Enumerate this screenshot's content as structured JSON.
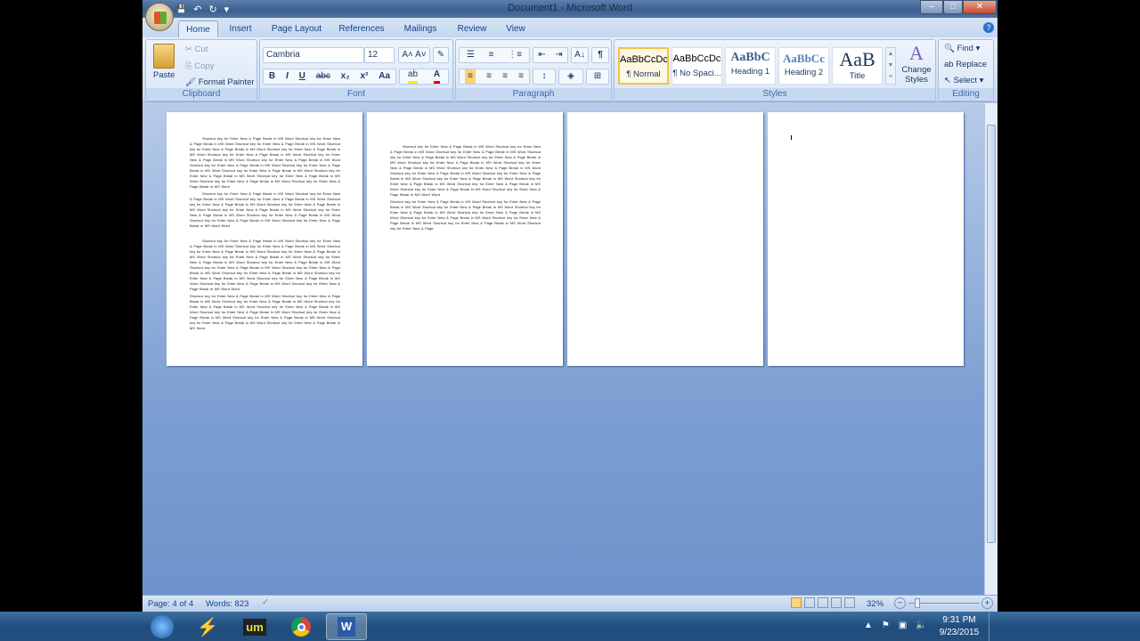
{
  "window": {
    "title": "Document1 - Microsoft Word",
    "min": "–",
    "max": "□",
    "close": "✕"
  },
  "qat": {
    "save": "💾",
    "undo": "↶",
    "redo": "↻",
    "customize": "▾"
  },
  "tabs": [
    "Home",
    "Insert",
    "Page Layout",
    "References",
    "Mailings",
    "Review",
    "View"
  ],
  "help": "?",
  "clipboard": {
    "paste": "Paste",
    "cut": "Cut",
    "copy": "Copy",
    "format_painter": "Format Painter",
    "label": "Clipboard"
  },
  "font": {
    "name": "Cambria",
    "size": "12",
    "grow": "A˄",
    "shrink": "A˅",
    "clear": "✎",
    "bold": "B",
    "italic": "I",
    "underline": "U",
    "strike": "abc",
    "sub": "x₂",
    "sup": "x²",
    "case": "Aa",
    "highlight": "ab",
    "color": "A",
    "label": "Font"
  },
  "paragraph": {
    "bullets": "☰",
    "numbering": "≡",
    "multilevel": "⋮≡",
    "dec_indent": "⇤",
    "inc_indent": "⇥",
    "sort": "A↓",
    "show": "¶",
    "left": "≡",
    "center": "≡",
    "right": "≡",
    "justify": "≡",
    "spacing": "↕",
    "shading": "◈",
    "borders": "⊞",
    "label": "Paragraph"
  },
  "styles": {
    "items": [
      {
        "preview": "AaBbCcDc",
        "name": "¶ Normal"
      },
      {
        "preview": "AaBbCcDc",
        "name": "¶ No Spaci..."
      },
      {
        "preview": "AaBbC",
        "name": "Heading 1"
      },
      {
        "preview": "AaBbCc",
        "name": "Heading 2"
      },
      {
        "preview": "AaB",
        "name": "Title"
      }
    ],
    "change": "Change Styles",
    "label": "Styles"
  },
  "editing": {
    "find": "Find",
    "replace": "Replace",
    "select": "Select",
    "label": "Editing"
  },
  "pages": [
    {
      "paragraphs": [
        "Shortcut key for Enter New & Page Break in MS Word Shortcut key for Enter New & Page Break in MS Word Shortcut key for Enter New & Page Break in MS Word Shortcut key for Enter New & Page Break in MS Word Shortcut key for Enter New & Page Break in MS Word Shortcut key for Enter New & Page Break in MS Word Shortcut key for Enter New & Page Break in MS Word Shortcut key for Enter New & Page Break in MS Word Shortcut key for Enter New & Page Break in MS Word Shortcut key for Enter New & Page Break in MS Word Shortcut key for Enter New & Page Break in MS Word Shortcut key for Enter New & Page Break in MS Word Shortcut key for Enter New & Page Break in MS Word Shortcut key for Enter New & Page Break in MS Word Shortcut key for Enter New & Page Break in MS Word",
        "Shortcut key for Enter New & Page Break in MS Word Shortcut key for Enter New & Page Break in MS Word Shortcut key for Enter New & Page Break in MS Word Shortcut key for Enter New & Page Break in MS Word Shortcut key for Enter New & Page Break in MS Word Shortcut key for Enter New & Page Break in MS Word Shortcut key for Enter New & Page Break in MS Word Shortcut key for Enter New & Page Break in MS Word Shortcut key for Enter New & Page Break in MS Word Shortcut key for Enter New & Page Break in MS Word Word",
        "Shortcut key for Enter New & Page Break in MS Word Shortcut key for Enter New & Page Break in MS Word Shortcut key for Enter New & Page Break in MS Word Shortcut key for Enter New & Page Break in MS Word Shortcut key for Enter New & Page Break in MS Word Shortcut key for Enter New & Page Break in MS Word Shortcut key for Enter New & Page Break in MS Word Shortcut key for Enter New & Page Break in MS Word Shortcut key for Enter New & Page Break in MS Word Shortcut key for Enter New & Page Break in MS Word Shortcut key for Enter New & Page Break in MS Word Shortcut key for Enter New & Page Break in MS Word Shortcut key for Enter New & Page Break in MS Word Shortcut key for Enter New & Page Break in MS Word Shortcut key for Enter New & Page Break in MS Word Word",
        "Shortcut key for Enter New & Page Break in MS Word Shortcut key for Enter New & Page Break in MS Word Shortcut key for Enter New & Page Break in MS Word Shortcut key for Enter New & Page Break in MS Word Shortcut key for Enter New & Page Break in MS Word Shortcut key for Enter New & Page Break in MS Word Shortcut key for Enter New & Page Break in MS Word Shortcut key for Enter New & Page Break in MS Word Shortcut key for Enter New & Page Break in MS Word Shortcut key for Enter New & Page Break in MS Word"
      ]
    },
    {
      "paragraphs": [
        "Shortcut key for Enter New & Page Break in MS Word Shortcut key for Enter New & Page Break in MS Word Shortcut key for Enter New & Page Break in MS Word Shortcut key for Enter New & Page Break in MS Word Shortcut key for Enter New & Page Break in MS Word Shortcut key for Enter New & Page Break in MS Word Shortcut key for Enter New & Page Break in MS Word Shortcut key for Enter New & Page Break in MS Word Shortcut key for Enter New & Page Break in MS Word Shortcut key for Enter New & Page Break in MS Word Shortcut key for Enter New & Page Break in MS Word Shortcut key for Enter New & Page Break in MS Word Shortcut key for Enter New & Page Break in MS Word Shortcut key for Enter New & Page Break in MS Word Shortcut key for Enter New & Page Break in MS Word Word",
        "Shortcut key for Enter New & Page Break in MS Word Shortcut key for Enter New & Page Break in MS Word Shortcut key for Enter New & Page Break in MS Word Shortcut key for Enter New & Page Break in MS Word Shortcut key for Enter New & Page Break in MS Word Shortcut key for Enter New & Page Break in MS Word Shortcut key for Enter New & Page Break in MS Word Shortcut key for Enter New & Page Break in MS Word Shortcut key for Enter New & Page"
      ]
    },
    {
      "paragraphs": []
    },
    {
      "paragraphs": []
    }
  ],
  "status": {
    "page": "Page: 4 of 4",
    "words": "Words: 823",
    "zoom": "32%",
    "zoom_out": "−",
    "zoom_in": "+"
  },
  "taskbar": {
    "time": "9:31 PM",
    "date": "9/23/2015"
  }
}
